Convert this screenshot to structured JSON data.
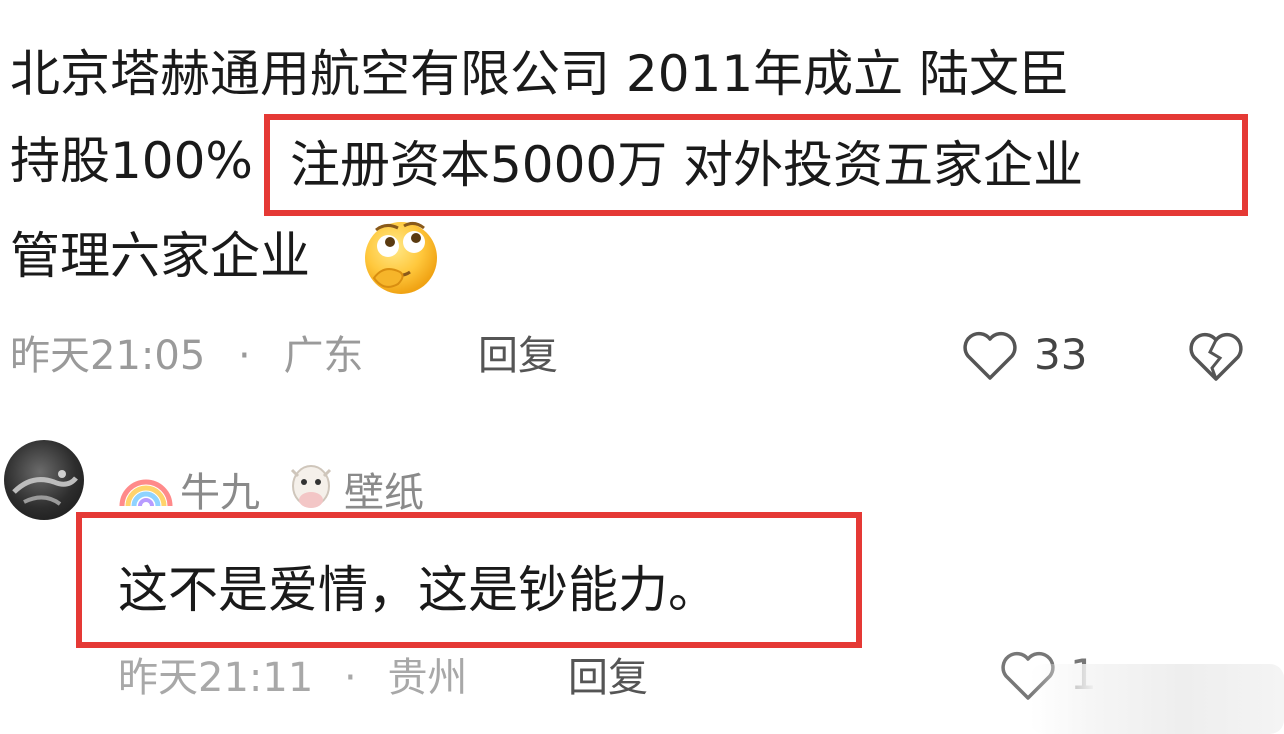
{
  "comment1": {
    "line1": "北京塔赫通用航空有限公司 2011年成立  陆文臣",
    "line2_prefix": "持股100%",
    "line2_highlight": "注册资本5000万 对外投资五家企业",
    "line3": "管理六家企业",
    "emoji_icon": "thinking-emoji",
    "time": "昨天21:05",
    "separator": "·",
    "location": "广东",
    "reply_label": "回复",
    "like_count": "33",
    "like_icon": "heart-outline-icon",
    "dislike_icon": "broken-heart-icon"
  },
  "comment2": {
    "avatar_icon": "avatar",
    "badge_icon": "rainbow-icon",
    "username_part1": "牛九",
    "cow_icon": "cow-face-icon",
    "username_part2": "壁纸",
    "text": "这不是爱情，这是钞能力。",
    "time": "昨天21:11",
    "separator": "·",
    "location": "贵州",
    "reply_label": "回复",
    "like_count": "1",
    "like_icon": "heart-outline-icon"
  },
  "colors": {
    "highlight_border": "#e53935",
    "meta_text": "#9a9a9a",
    "body_text": "#1a1a1a"
  }
}
